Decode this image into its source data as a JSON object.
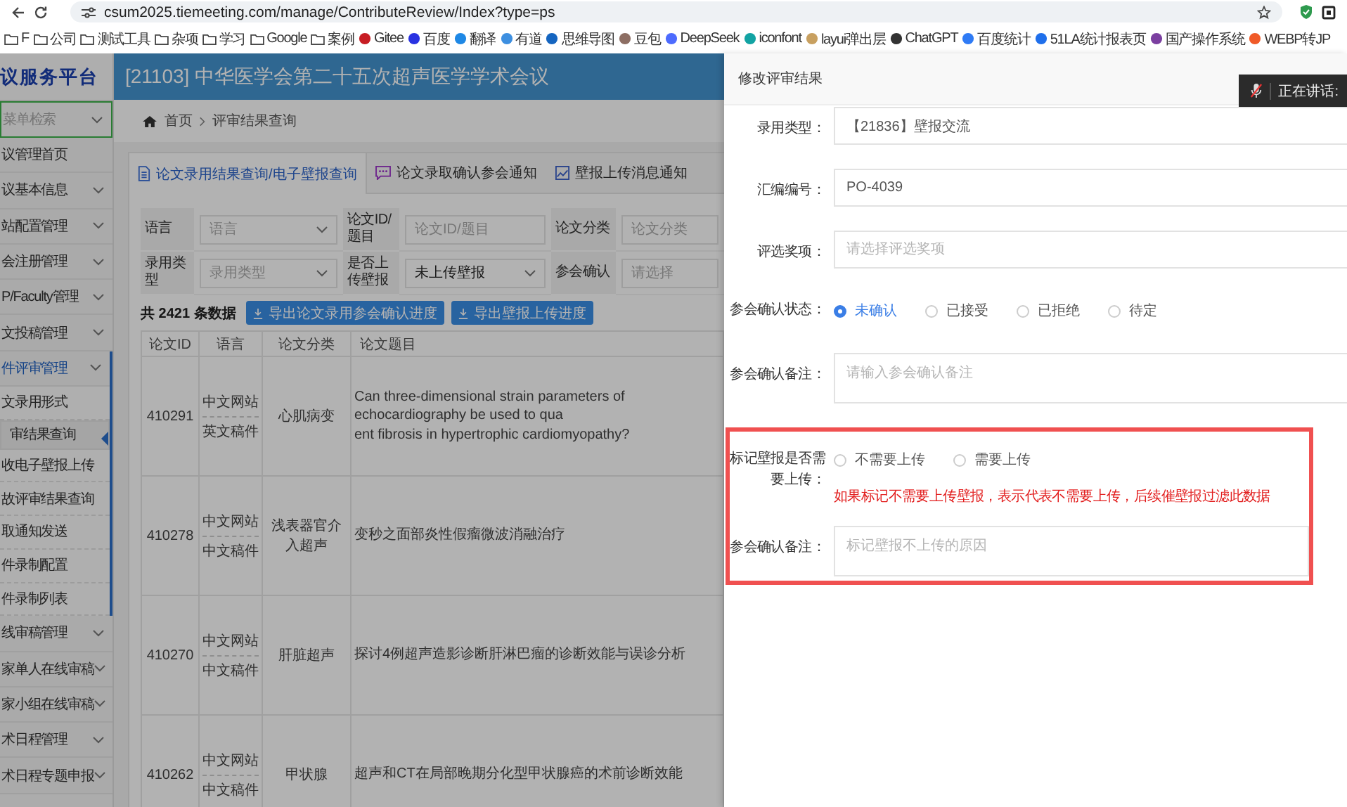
{
  "browser": {
    "url": "csum2025.tiemeeting.com/manage/ContributeReview/Index?type=ps",
    "bookmarks": [
      {
        "label": "F",
        "kind": "folder"
      },
      {
        "label": "公司",
        "kind": "folder"
      },
      {
        "label": "测试工具",
        "kind": "folder"
      },
      {
        "label": "杂项",
        "kind": "folder"
      },
      {
        "label": "学习",
        "kind": "folder"
      },
      {
        "label": "Google",
        "kind": "folder"
      },
      {
        "label": "案例",
        "kind": "folder"
      },
      {
        "label": "Gitee",
        "kind": "site",
        "color": "#c71d23"
      },
      {
        "label": "百度",
        "kind": "site",
        "color": "#2932e1"
      },
      {
        "label": "翻译",
        "kind": "site",
        "color": "#1e88e5"
      },
      {
        "label": "有道",
        "kind": "site",
        "color": "#3d8fe0"
      },
      {
        "label": "思维导图",
        "kind": "site",
        "color": "#1565c0"
      },
      {
        "label": "豆包",
        "kind": "site",
        "color": "#8d6e63"
      },
      {
        "label": "DeepSeek",
        "kind": "site",
        "color": "#4d6bfe"
      },
      {
        "label": "iconfont",
        "kind": "site",
        "color": "#12a3a3"
      },
      {
        "label": "layui弹出层",
        "kind": "site",
        "color": "#c8a060"
      },
      {
        "label": "ChatGPT",
        "kind": "site",
        "color": "#333333"
      },
      {
        "label": "百度统计",
        "kind": "site",
        "color": "#2f7bf5"
      },
      {
        "label": "51LA统计报表页",
        "kind": "site",
        "color": "#1f6feb"
      },
      {
        "label": "国产操作系统",
        "kind": "site",
        "color": "#7b3fa0"
      },
      {
        "label": "WEBP转JP",
        "kind": "site",
        "color": "#f05a28"
      }
    ]
  },
  "app": {
    "logo": "议服务平台",
    "title": "[21103] 中华医学会第二十五次超声医学学术会议",
    "sidebar": {
      "search_placeholder": "菜单检索",
      "items": [
        {
          "label": "议管理首页",
          "kind": "page"
        },
        {
          "label": "议基本信息",
          "kind": "group",
          "expanded": false
        },
        {
          "label": "站配置管理",
          "kind": "group",
          "expanded": false
        },
        {
          "label": "会注册管理",
          "kind": "group",
          "expanded": false
        },
        {
          "label": "P/Faculty管理",
          "kind": "group",
          "expanded": false
        },
        {
          "label": "文投稿管理",
          "kind": "group",
          "expanded": false
        },
        {
          "label": "件评审管理",
          "kind": "group",
          "expanded": true,
          "children": [
            {
              "label": "文录用形式",
              "selected": false
            },
            {
              "label": "审结果查询",
              "selected": true
            },
            {
              "label": "收电子壁报上传",
              "selected": false
            },
            {
              "label": "故评审结果查询",
              "selected": false
            },
            {
              "label": "取通知发送",
              "selected": false
            },
            {
              "label": "件录制配置",
              "selected": false
            },
            {
              "label": "件录制列表",
              "selected": false
            }
          ]
        },
        {
          "label": "线审稿管理",
          "kind": "group",
          "expanded": false
        },
        {
          "label": "家单人在线审稿",
          "kind": "group",
          "expanded": false
        },
        {
          "label": "家小组在线审稿",
          "kind": "group",
          "expanded": false
        },
        {
          "label": "术日程管理",
          "kind": "group",
          "expanded": false
        },
        {
          "label": "术日程专题申报",
          "kind": "group",
          "expanded": false
        }
      ]
    },
    "breadcrumb": [
      "首页",
      "评审结果查询"
    ],
    "tabs": [
      {
        "label": "论文录用结果查询/电子壁报查询",
        "selected": true
      },
      {
        "label": "论文录取确认参会通知",
        "selected": false
      },
      {
        "label": "壁报上传消息通知",
        "selected": false
      }
    ],
    "filters": [
      {
        "label": "语言",
        "kind": "select",
        "placeholder": "语言"
      },
      {
        "label": "论文ID/题目",
        "kind": "input",
        "placeholder": "论文ID/题目"
      },
      {
        "label": "论文分类",
        "kind": "input",
        "placeholder": "论文分类"
      },
      {
        "label": "录用类型",
        "kind": "select",
        "placeholder": "录用类型"
      },
      {
        "label": "是否上传壁报",
        "kind": "select",
        "value": "未上传壁报"
      },
      {
        "label": "参会确认",
        "kind": "input",
        "placeholder": "请选择"
      }
    ],
    "count": "共 2421 条数据",
    "buttons": [
      "导出论文录用参会确认进度",
      "导出壁报上传进度"
    ],
    "table": {
      "columns": [
        "论文ID",
        "语言",
        "论文分类",
        "论文题目"
      ],
      "rows": [
        {
          "id": "410291",
          "languages": [
            "中文网站",
            "英文稿件"
          ],
          "category": "心肌病变",
          "title_lines": [
            "Can three-dimensional strain parameters of echocardiography be used to qua",
            "ent fibrosis in hypertrophic cardiomyopathy?"
          ]
        },
        {
          "id": "410278",
          "languages": [
            "中文网站",
            "中文稿件"
          ],
          "category": "浅表器官介入超声",
          "title_lines": [
            "变秒之面部炎性假瘤微波消融治疗"
          ]
        },
        {
          "id": "410270",
          "languages": [
            "中文网站",
            "中文稿件"
          ],
          "category": "肝脏超声",
          "title_lines": [
            "探讨4例超声造影诊断肝淋巴瘤的诊断效能与误诊分析"
          ]
        },
        {
          "id": "410262",
          "languages": [
            "中文网站",
            "中文稿件"
          ],
          "category": "甲状腺",
          "title_lines": [
            "超声和CT在局部晚期分化型甲状腺癌的术前诊断效能"
          ]
        }
      ]
    }
  },
  "drawer": {
    "title": "修改评审结果",
    "speaking_indicator": "正在讲话:",
    "fields": [
      {
        "label": "录用类型：",
        "kind": "input",
        "value": "【21836】壁报交流"
      },
      {
        "label": "汇编编号：",
        "kind": "input",
        "value": "PO-4039"
      },
      {
        "label": "评选奖项：",
        "kind": "input",
        "placeholder": "请选择评选奖项"
      },
      {
        "label": "参会确认状态：",
        "kind": "radio",
        "options": [
          {
            "label": "未确认",
            "selected": true
          },
          {
            "label": "已接受",
            "selected": false
          },
          {
            "label": "已拒绝",
            "selected": false
          },
          {
            "label": "待定",
            "selected": false
          }
        ]
      },
      {
        "label": "参会确认备注：",
        "kind": "textarea",
        "placeholder": "请输入参会确认备注"
      }
    ],
    "highlighted_fields": [
      {
        "label": "标记壁报是否需要上传：",
        "kind": "radio",
        "options": [
          {
            "label": "不需要上传",
            "selected": false
          },
          {
            "label": "需要上传",
            "selected": false
          }
        ],
        "note": "如果标记不需要上传壁报，表示代表不需要上传，后续催壁报过滤此数据"
      },
      {
        "label": "参会确认备注：",
        "kind": "textarea",
        "placeholder": "标记壁报不上传的原因"
      }
    ]
  }
}
